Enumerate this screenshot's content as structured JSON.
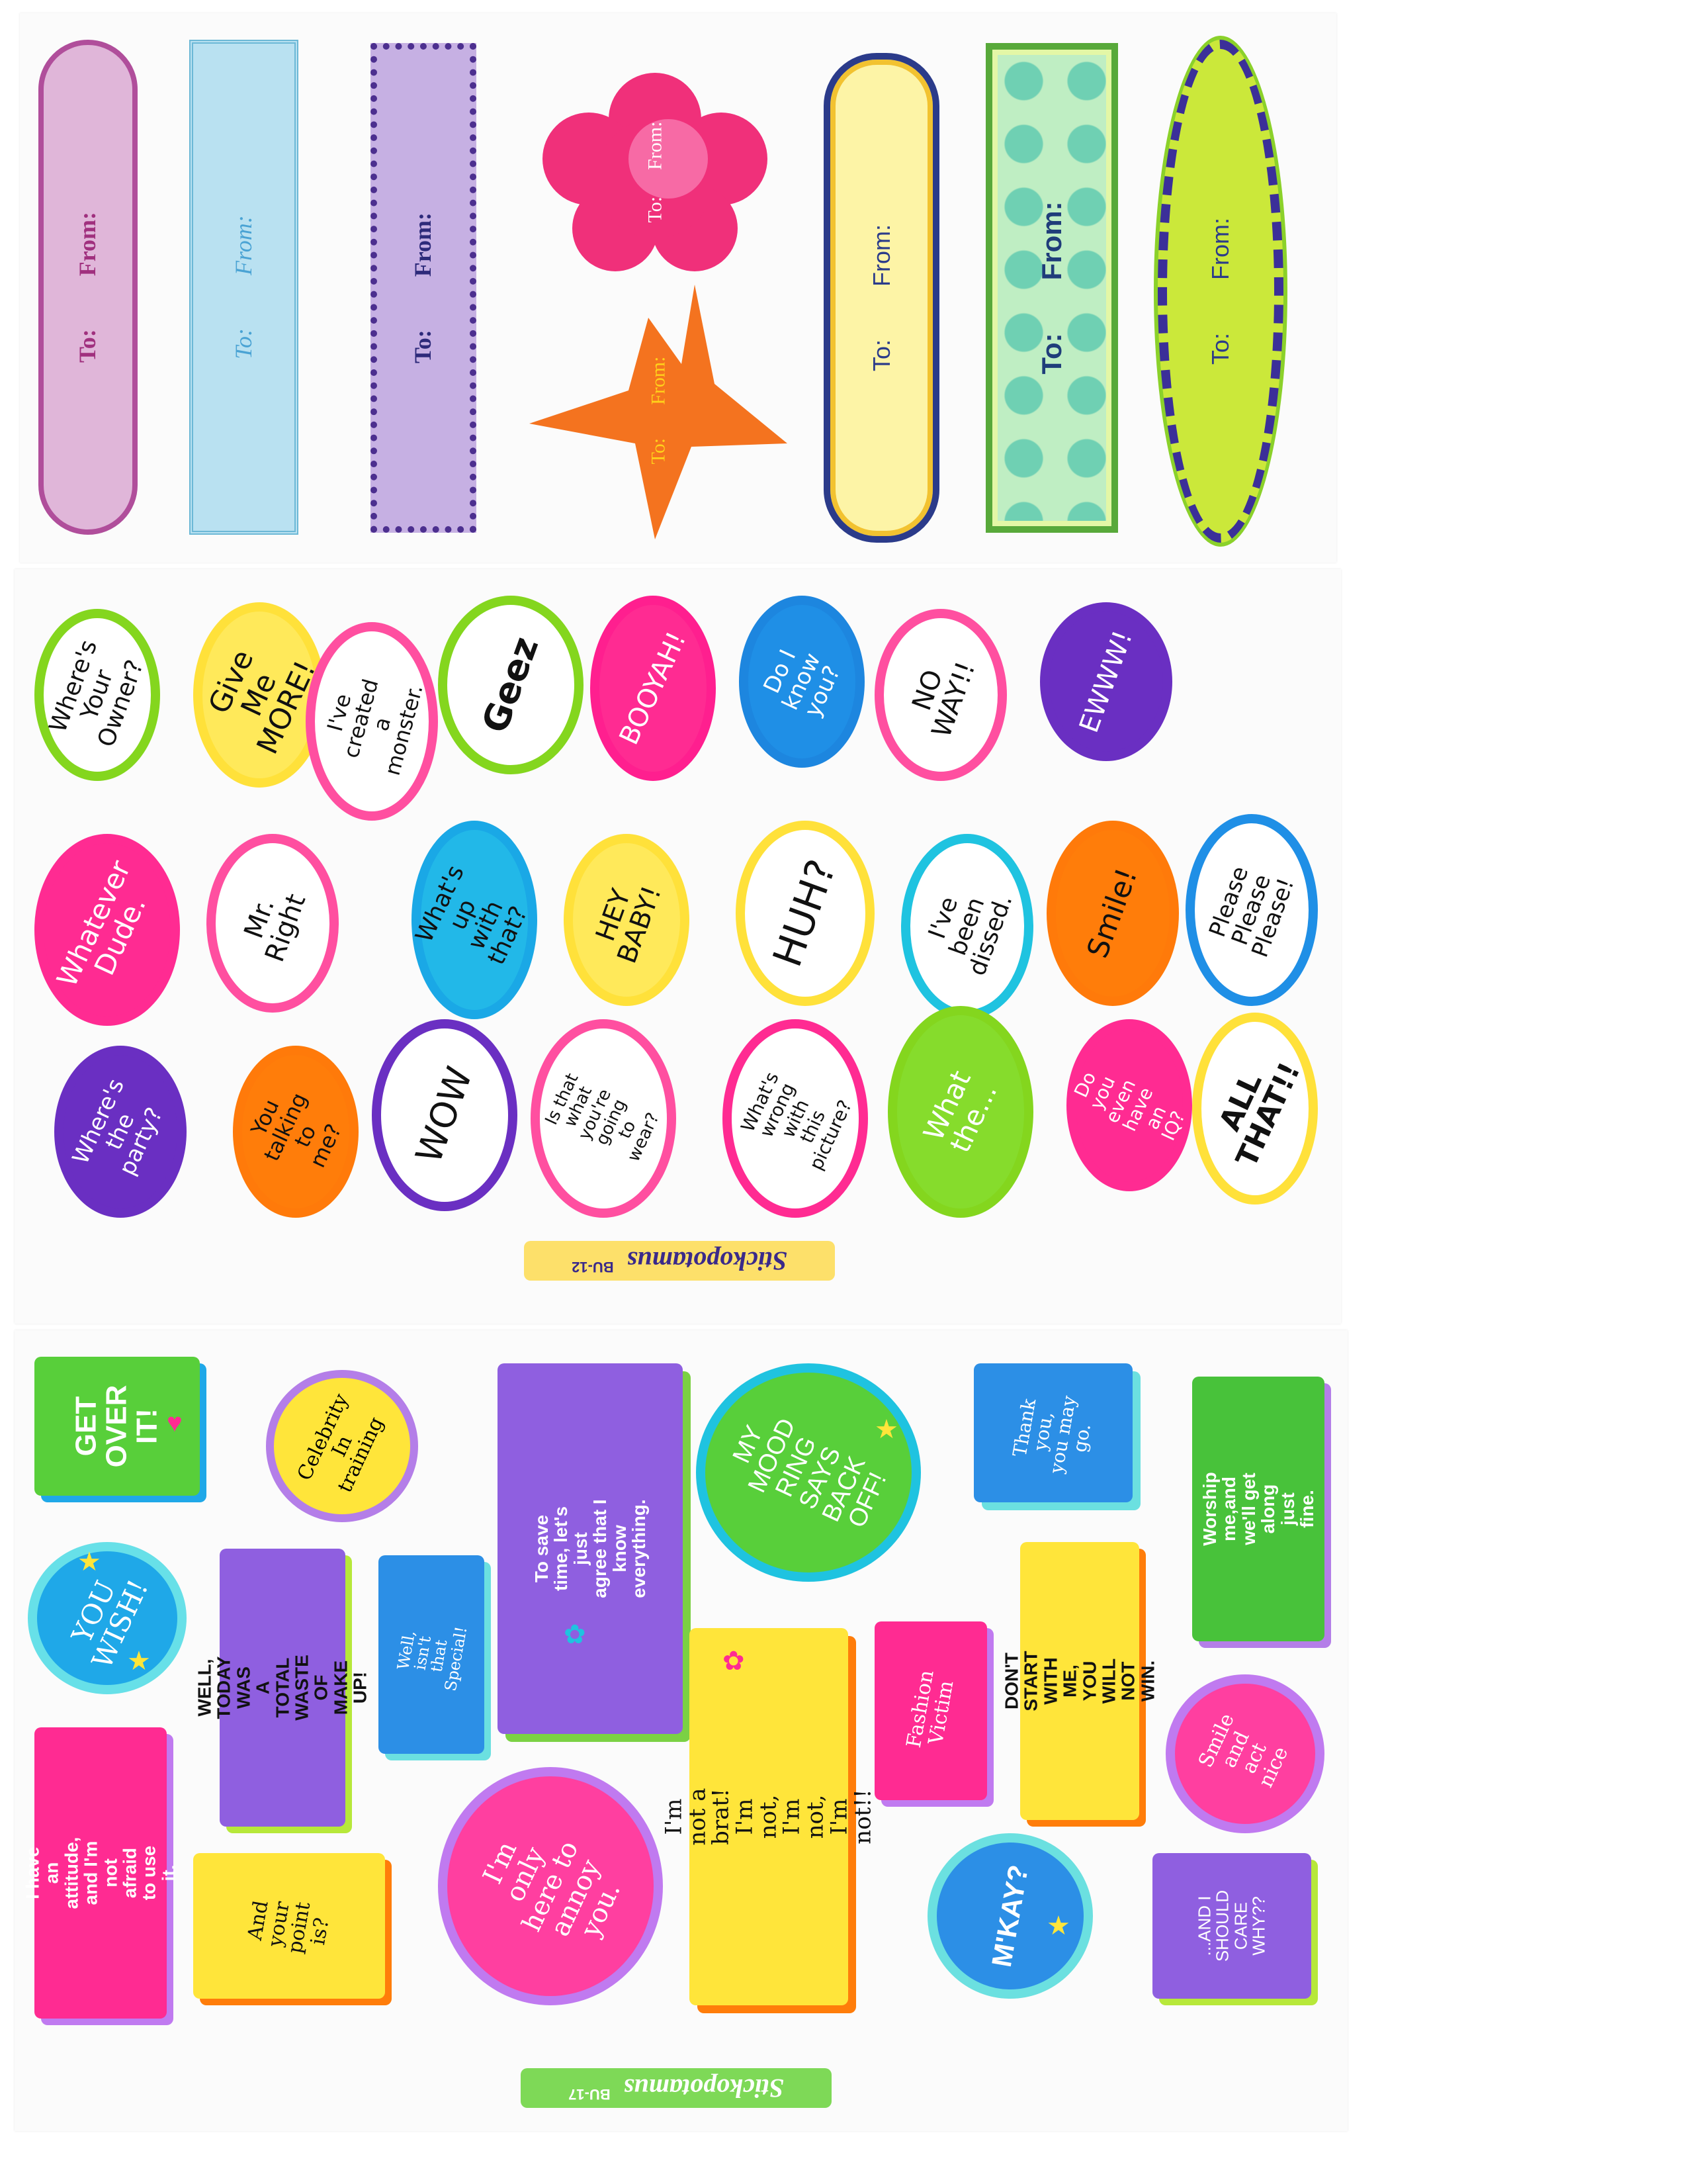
{
  "sheet1": {
    "tags": [
      {
        "to": "To:",
        "from": "From:",
        "color": "#a0307e"
      },
      {
        "to": "To:",
        "from": "From:",
        "color": "#4aa3d4"
      },
      {
        "to": "To:",
        "from": "From:",
        "color": "#2d2a7a"
      },
      {
        "to": "To:",
        "from": "From:",
        "color": "#ffffff"
      },
      {
        "to": "To:",
        "from": "From:",
        "color": "#ffd21a"
      },
      {
        "to": "To:",
        "from": "From:",
        "color": "#2b3b8a"
      },
      {
        "to": "To:",
        "from": "From:",
        "color": "#1f3d7a"
      },
      {
        "to": "To:",
        "from": "From:",
        "color": "#2b3b8a"
      }
    ]
  },
  "sheet2": {
    "bubbles": [
      {
        "text": "Where's\nYour\nOwner?"
      },
      {
        "text": "Give Me\nMORE!"
      },
      {
        "text": "I've created a\nmonster."
      },
      {
        "text": "Geez"
      },
      {
        "text": "BOOYAH!"
      },
      {
        "text": "Do I\nknow you?"
      },
      {
        "text": "NO\nWAY!!"
      },
      {
        "text": "EWWW!"
      },
      {
        "text": "Whatever\nDude."
      },
      {
        "text": "Mr. Right"
      },
      {
        "text": "What's up\nwith that?"
      },
      {
        "text": "HEY\nBABY!"
      },
      {
        "text": "HUH?"
      },
      {
        "text": "I've been\ndissed."
      },
      {
        "text": "Smile!"
      },
      {
        "text": "Please\nPlease\nPlease!"
      },
      {
        "text": "Where's\nthe party?"
      },
      {
        "text": "You talking\nto me?"
      },
      {
        "text": "WOW"
      },
      {
        "text": "Is that what\nyou're going\nto wear?"
      },
      {
        "text": "What's\nwrong with\nthis picture?"
      },
      {
        "text": "What\nthe..."
      },
      {
        "text": "Do you even\nhave an IQ?"
      },
      {
        "text": "ALL\nTHAT!!"
      }
    ],
    "brand": "Stickopotamus",
    "code": "BU-12"
  },
  "sheet3": {
    "stickers": [
      {
        "text": "GET\nOVER\nIT!"
      },
      {
        "text": "Celebrity\nIn\ntraining"
      },
      {
        "text": "To save time, let's just\nagree that I know\neverything."
      },
      {
        "text": "MY MOOD\nRING SAYS\nBACK OFF!"
      },
      {
        "text": "Thank\nyou,\nyou may\ngo."
      },
      {
        "text": "Worship me,and\nwe'll get along\njust fine."
      },
      {
        "text": "YOU\nWISH!"
      },
      {
        "text": "WELL, TODAY WAS\nA TOTAL WASTE OF\nMAKE UP!"
      },
      {
        "text": "Well, isn't that\nSpecial!"
      },
      {
        "text": "DON'T START WITH\nME, YOU WILL\nNOT WIN."
      },
      {
        "text": "Fashion\nVictim"
      },
      {
        "text": "I'm not a brat!\nI'm not, I'm not, I'm not!!"
      },
      {
        "text": "I have an attitude,\nand I'm not afraid\nto use it."
      },
      {
        "text": "And\nyour\npoint\nis?"
      },
      {
        "text": "I'm only\nhere to\nannoy you."
      },
      {
        "text": "M'KAY?"
      },
      {
        "text": "Smile\nand\nact nice"
      },
      {
        "text": "...AND I\nSHOULD\nCARE\nWHY??"
      }
    ],
    "brand": "Stickopotamus",
    "code": "BU-17"
  }
}
